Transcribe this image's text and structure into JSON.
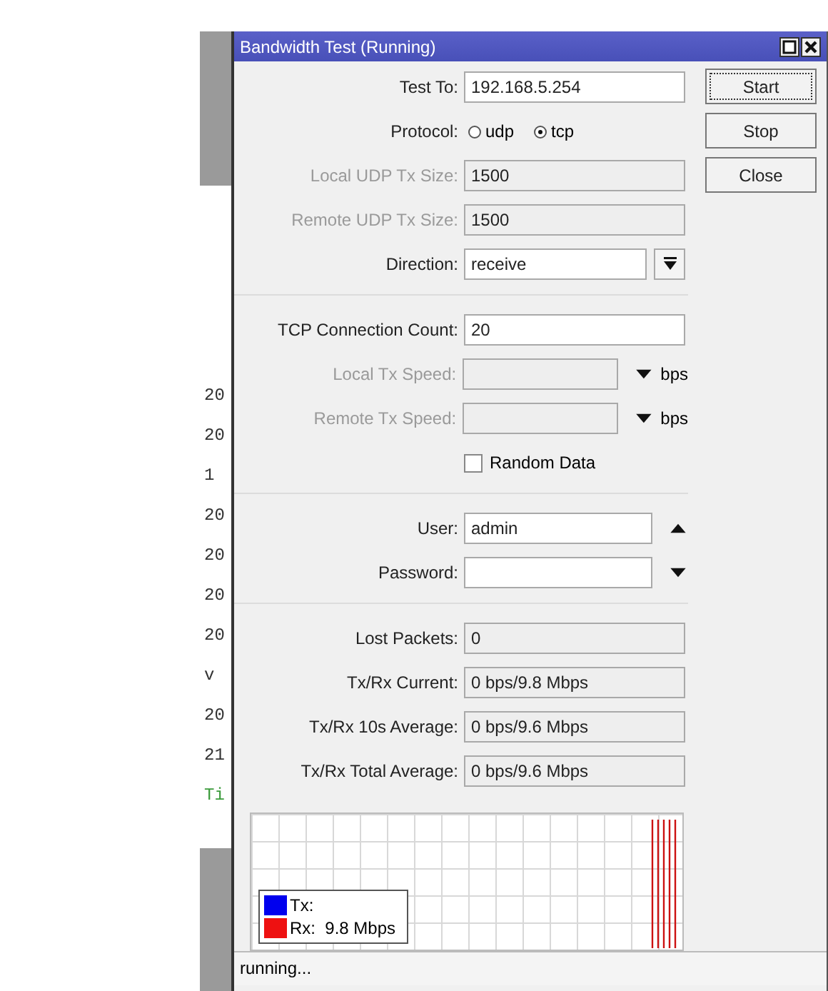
{
  "terminal": {
    "lines": [
      {
        "text": "20",
        "color": "#333333"
      },
      {
        "text": "20",
        "color": "#333333"
      },
      {
        "text": "1",
        "color": "#333333"
      },
      {
        "text": "20",
        "color": "#333333"
      },
      {
        "text": "20",
        "color": "#333333"
      },
      {
        "text": "20",
        "color": "#333333"
      },
      {
        "text": "20",
        "color": "#333333"
      },
      {
        "text": "v",
        "color": "#333333"
      },
      {
        "text": "20",
        "color": "#333333"
      },
      {
        "text": "21",
        "color": "#333333"
      },
      {
        "text": "Ti",
        "color": "#3a9a3a"
      }
    ]
  },
  "window": {
    "title": "Bandwidth Test (Running)"
  },
  "sections": [
    [
      {
        "kind": "text",
        "label": "Test To:",
        "value": "192.168.5.254",
        "disabled": false
      },
      {
        "kind": "radio",
        "label": "Protocol:",
        "options": [
          {
            "label": "udp",
            "selected": false
          },
          {
            "label": "tcp",
            "selected": true
          }
        ]
      },
      {
        "kind": "text",
        "label": "Local UDP Tx Size:",
        "value": "1500",
        "disabled": true
      },
      {
        "kind": "text",
        "label": "Remote UDP Tx Size:",
        "value": "1500",
        "disabled": true
      },
      {
        "kind": "select",
        "label": "Direction:",
        "value": "receive"
      }
    ],
    [
      {
        "kind": "text",
        "label": "TCP Connection Count:",
        "value": "20",
        "disabled": false
      },
      {
        "kind": "speed",
        "label": "Local Tx Speed:",
        "unit": "bps",
        "disabled": true
      },
      {
        "kind": "speed",
        "label": "Remote Tx Speed:",
        "unit": "bps",
        "disabled": true
      },
      {
        "kind": "checkbox",
        "label": "Random Data",
        "checked": false
      }
    ],
    [
      {
        "kind": "spin",
        "label": "User:",
        "value": "admin",
        "expanded": true
      },
      {
        "kind": "spin",
        "label": "Password:",
        "expanded": false
      }
    ],
    [
      {
        "kind": "readonly",
        "label": "Lost Packets:",
        "value": "0"
      },
      {
        "kind": "readonly",
        "label": "Tx/Rx Current:",
        "value": "0 bps/9.8 Mbps"
      },
      {
        "kind": "readonly",
        "label": "Tx/Rx 10s Average:",
        "value": "0 bps/9.6 Mbps"
      },
      {
        "kind": "readonly",
        "label": "Tx/Rx Total Average:",
        "value": "0 bps/9.6 Mbps"
      }
    ]
  ],
  "buttons": [
    {
      "label": "Start",
      "focused": true
    },
    {
      "label": "Stop",
      "focused": false
    },
    {
      "label": "Close",
      "focused": false
    }
  ],
  "graph": {
    "legend": [
      {
        "label": "Tx:",
        "color": "#0000ee"
      },
      {
        "label": "Rx:  9.8 Mbps",
        "color": "#ee1111"
      }
    ]
  },
  "status_bar": "running..."
}
